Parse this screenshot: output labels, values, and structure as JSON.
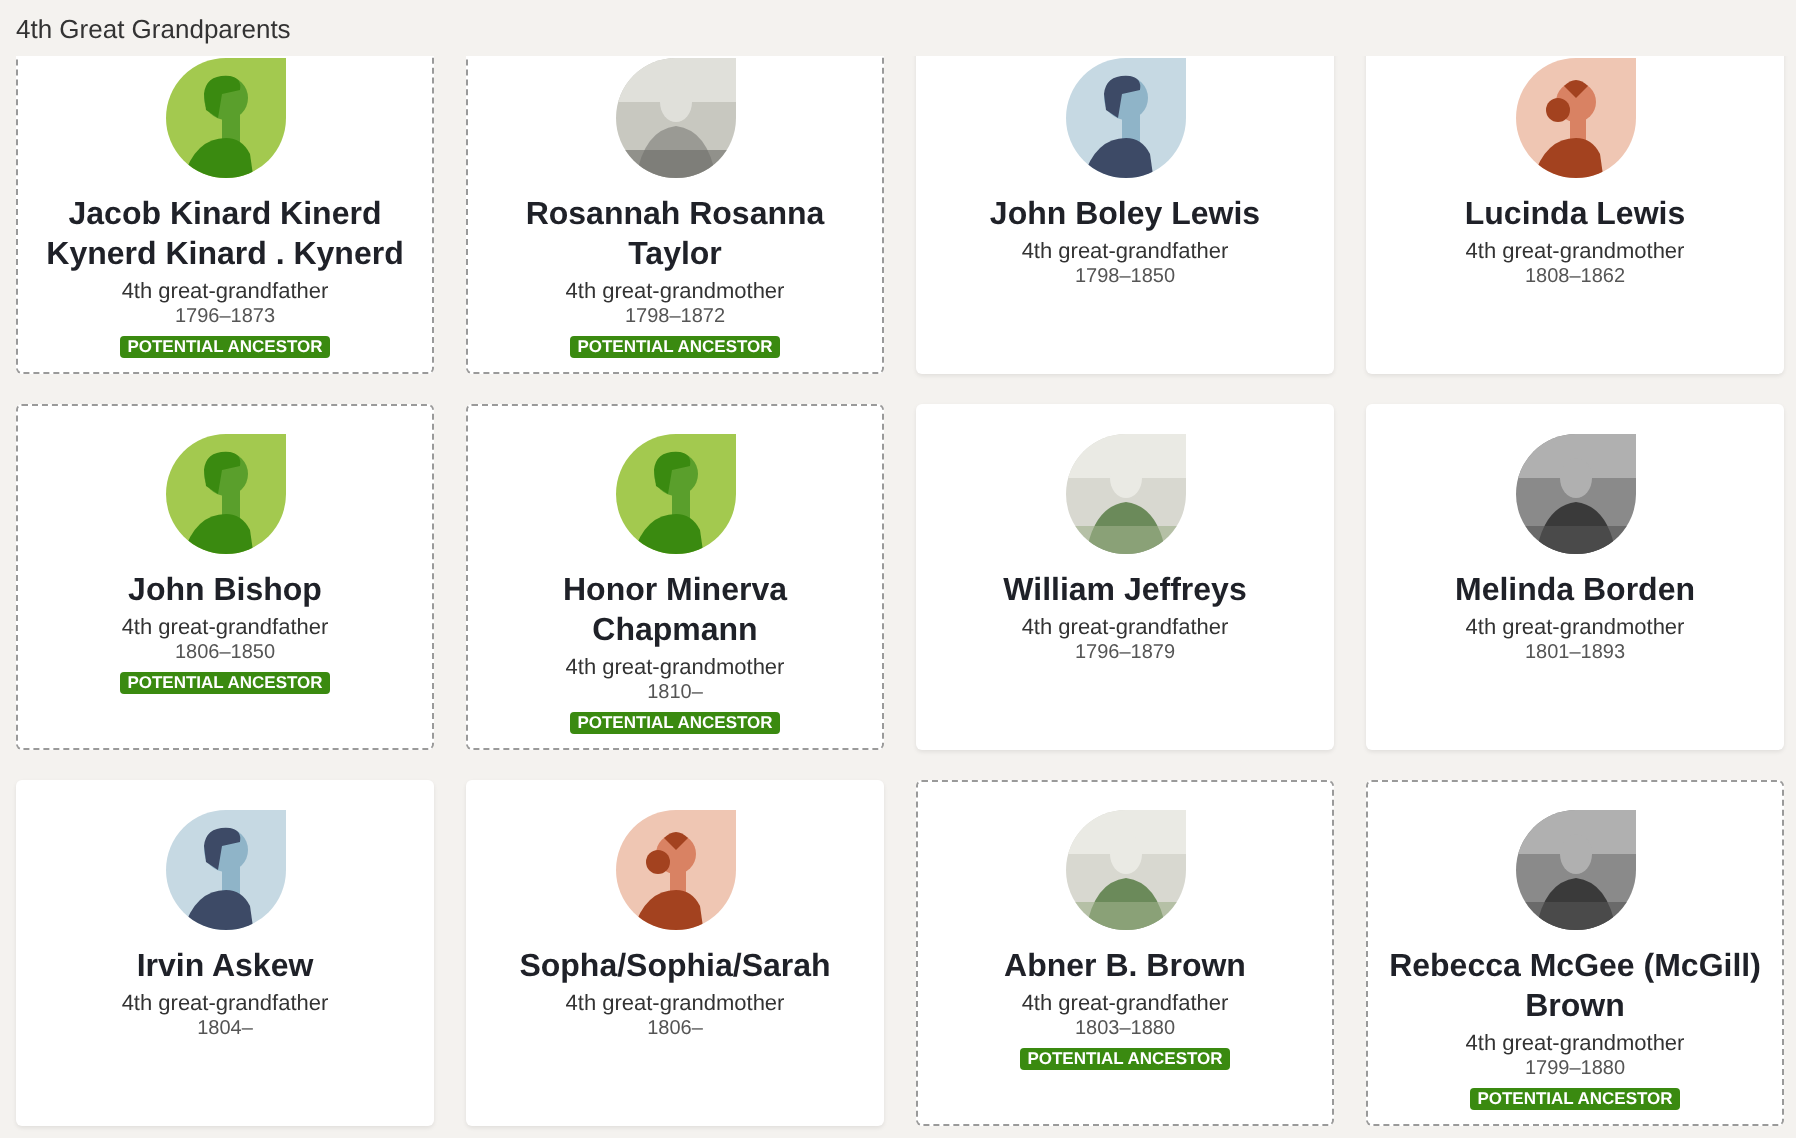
{
  "section": {
    "title": "4th Great Grandparents"
  },
  "people": [
    {
      "name": "Jacob Kinard Kinerd Kynerd Kinard . Kynerd",
      "relation": "4th great-grandfather",
      "dates": "1796–1873",
      "avatar": {
        "kind": "green"
      },
      "potential": true,
      "badge": "POTENTIAL ANCESTOR"
    },
    {
      "name": "Rosannah Rosanna Taylor",
      "relation": "4th great-grandmother",
      "dates": "1798–1872",
      "potential": true,
      "badge": "POTENTIAL ANCESTOR"
    },
    {
      "name": "John Boley Lewis",
      "relation": "4th great-grandfather",
      "dates": "1798–1850",
      "avatar": {
        "kind": "male"
      },
      "potential": false
    },
    {
      "name": "Lucinda Lewis",
      "relation": "4th great-grandmother",
      "dates": "1808–1862",
      "avatar": {
        "kind": "female"
      },
      "potential": false
    },
    {
      "name": "John Bishop",
      "relation": "4th great-grandfather",
      "dates": "1806–1850",
      "avatar": {
        "kind": "green"
      },
      "potential": true,
      "badge": "POTENTIAL ANCESTOR"
    },
    {
      "name": "Honor Minerva Chapmann",
      "relation": "4th great-grandmother",
      "dates": "1810–",
      "avatar": {
        "kind": "green"
      },
      "potential": true,
      "badge": "POTENTIAL ANCESTOR"
    },
    {
      "name": "William Jeffreys",
      "relation": "4th great-grandfather",
      "dates": "1796–1879",
      "potential": false
    },
    {
      "name": "Melinda Borden",
      "relation": "4th great-grandmother",
      "dates": "1801–1893",
      "potential": false
    },
    {
      "name": "Irvin Askew",
      "relation": "4th great-grandfather",
      "dates": "1804–",
      "avatar": {
        "kind": "male"
      },
      "potential": false
    },
    {
      "name": "Sopha/Sophia/Sarah",
      "relation": "4th great-grandmother",
      "dates": "1806–",
      "avatar": {
        "kind": "female"
      },
      "potential": false
    },
    {
      "name": "Abner B. Brown",
      "relation": "4th great-grandfather",
      "dates": "1803–1880",
      "potential": true,
      "badge": "POTENTIAL ANCESTOR"
    },
    {
      "name": "Rebecca McGee (McGill) Brown",
      "relation": "4th great-grandmother",
      "dates": "1799–1880",
      "potential": true,
      "badge": "POTENTIAL ANCESTOR"
    }
  ]
}
